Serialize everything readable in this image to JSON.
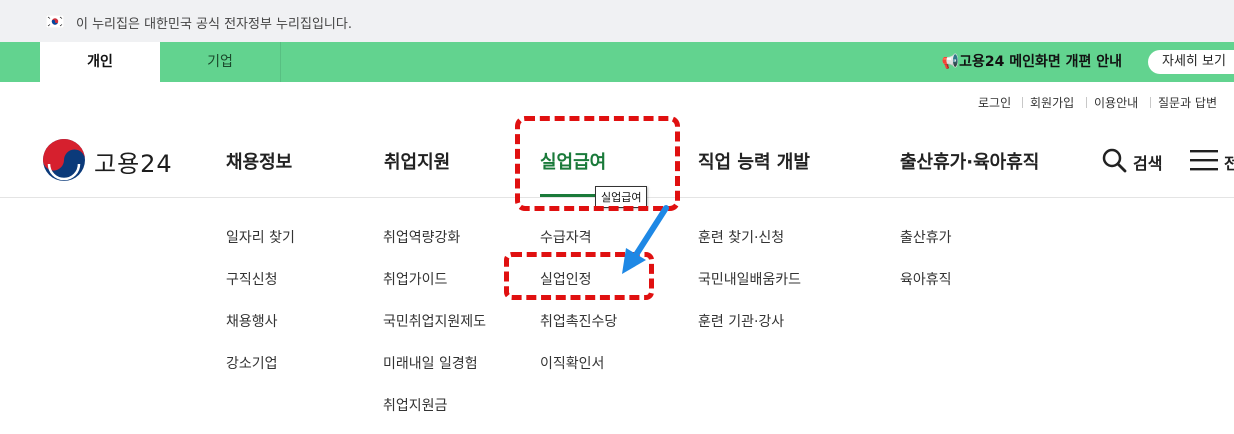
{
  "gov_bar": {
    "text": "이 누리집은 대한민국 공식 전자정부 누리집입니다."
  },
  "tabs": [
    {
      "label": "개인"
    },
    {
      "label": "기업"
    }
  ],
  "notice": {
    "text": "📢고용24 메인화면 개편 안내",
    "button_label": "자세히 보기"
  },
  "util_menu": [
    {
      "label": "로그인"
    },
    {
      "label": "회원가입"
    },
    {
      "label": "이용안내"
    },
    {
      "label": "질문과 답변"
    }
  ],
  "logo": {
    "text": "고용24"
  },
  "gnb": [
    {
      "label": "채용정보"
    },
    {
      "label": "취업지원"
    },
    {
      "label": "실업급여"
    },
    {
      "label": "직업 능력 개발"
    },
    {
      "label": "출산휴가·육아휴직"
    }
  ],
  "search": {
    "label": "검색"
  },
  "menu": {
    "label": "전"
  },
  "submenus": {
    "col1": [
      "일자리 찾기",
      "구직신청",
      "채용행사",
      "강소기업"
    ],
    "col2": [
      "취업역량강화",
      "취업가이드",
      "국민취업지원제도",
      "미래내일 일경험",
      "취업지원금"
    ],
    "col3": [
      "수급자격",
      "실업인정",
      "취업촉진수당",
      "이직확인서"
    ],
    "col4": [
      "훈련 찾기·신청",
      "국민내일배움카드",
      "훈련 기관·강사"
    ],
    "col5": [
      "출산휴가",
      "육아휴직"
    ]
  },
  "tooltip": {
    "text": "실업급여"
  },
  "colors": {
    "brand_green": "#62d38f",
    "active_green": "#1a7a3a",
    "annotation_red": "#e01010",
    "arrow_blue": "#1e88e5"
  }
}
